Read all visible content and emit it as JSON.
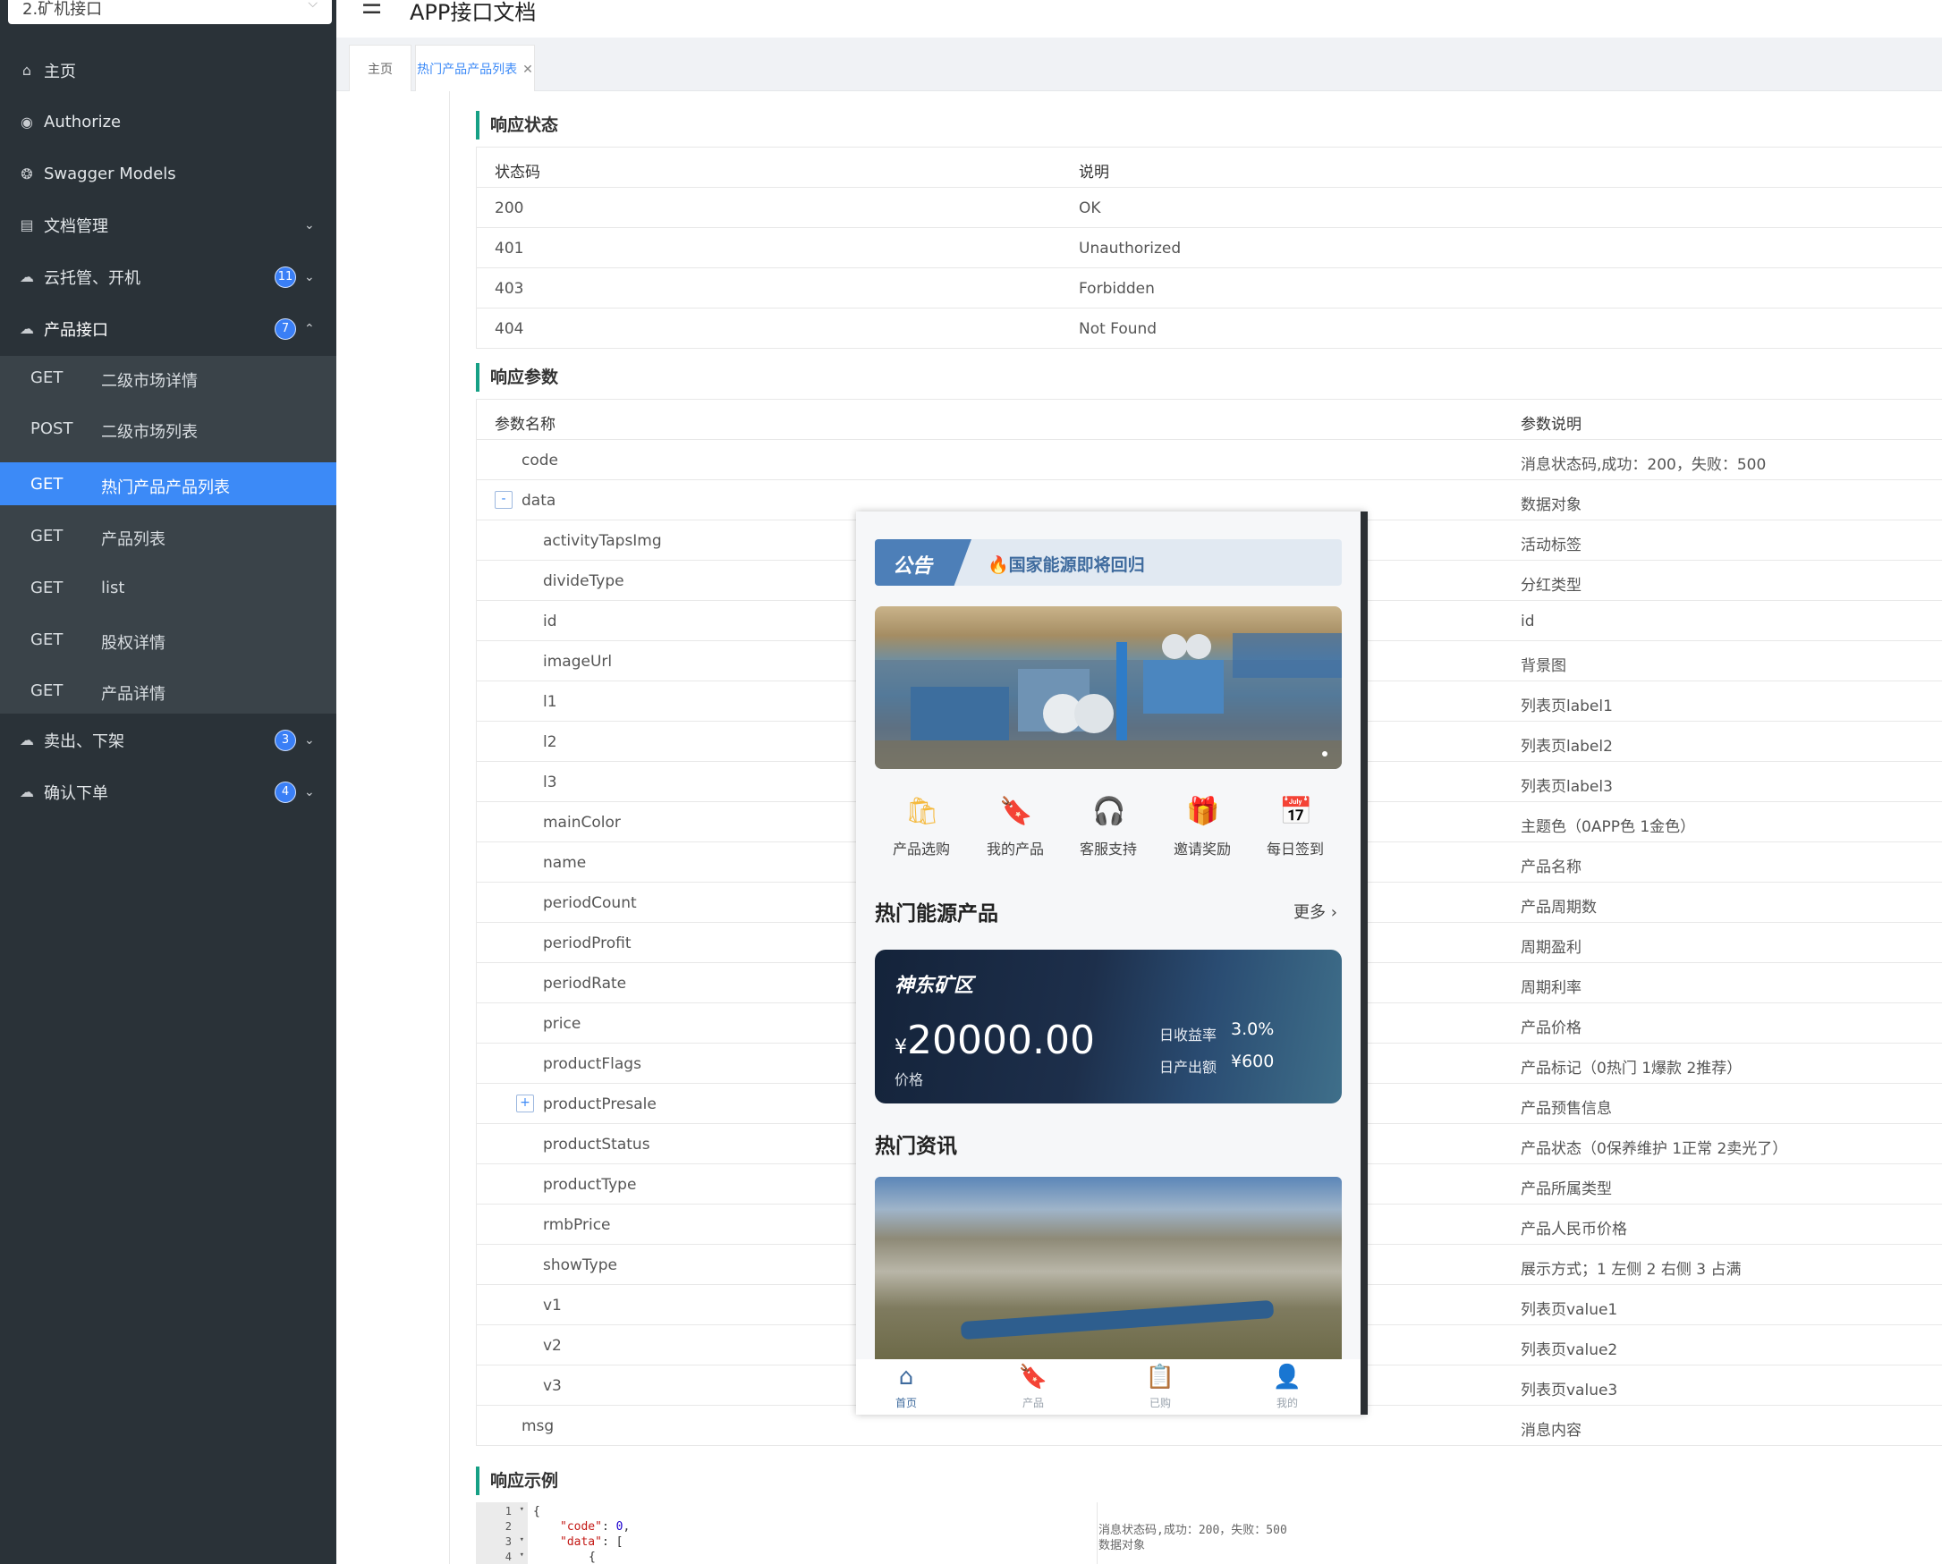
{
  "sidebar": {
    "group_select": "2.矿机接口",
    "menu": [
      {
        "icon": "home-icon",
        "glyph": "⌂",
        "label": "主页"
      },
      {
        "icon": "authorize-icon",
        "glyph": "◉",
        "label": "Authorize"
      },
      {
        "icon": "models-icon",
        "glyph": "❂",
        "label": "Swagger Models"
      },
      {
        "icon": "document-icon",
        "glyph": "▤",
        "label": "文档管理"
      },
      {
        "icon": "cloud-icon",
        "glyph": "☁",
        "label": "云托管、开机",
        "badge": "11"
      },
      {
        "icon": "cloud-icon",
        "glyph": "☁",
        "label": "产品接口",
        "badge": "7"
      },
      {
        "icon": "cloud-icon",
        "glyph": "☁",
        "label": "卖出、下架",
        "badge": "3"
      },
      {
        "icon": "cloud-icon",
        "glyph": "☁",
        "label": "确认下单",
        "badge": "4"
      }
    ],
    "submenu": [
      {
        "method": "GET",
        "name": "二级市场详情"
      },
      {
        "method": "POST",
        "name": "二级市场列表"
      },
      {
        "method": "GET",
        "name": "热门产品产品列表"
      },
      {
        "method": "GET",
        "name": "产品列表"
      },
      {
        "method": "GET",
        "name": "list"
      },
      {
        "method": "GET",
        "name": "股权详情"
      },
      {
        "method": "GET",
        "name": "产品详情"
      }
    ]
  },
  "header": {
    "title": "APP接口文档"
  },
  "tabs": {
    "home": "主页",
    "current": "热门产品产品列表"
  },
  "response_status": {
    "title": "响应状态",
    "headers": [
      "状态码",
      "说明"
    ],
    "rows": [
      [
        "200",
        "OK"
      ],
      [
        "401",
        "Unauthorized"
      ],
      [
        "403",
        "Forbidden"
      ],
      [
        "404",
        "Not Found"
      ]
    ]
  },
  "response_params": {
    "title": "响应参数",
    "headers": [
      "参数名称",
      "参数说明"
    ],
    "rows": [
      [
        "code",
        "消息状态码,成功：200，失败：500"
      ],
      [
        "data",
        "数据对象"
      ],
      [
        "activityTapsImg",
        "活动标签"
      ],
      [
        "divideType",
        "分红类型"
      ],
      [
        "id",
        "id"
      ],
      [
        "imageUrl",
        "背景图"
      ],
      [
        "l1",
        "列表页label1"
      ],
      [
        "l2",
        "列表页label2"
      ],
      [
        "l3",
        "列表页label3"
      ],
      [
        "mainColor",
        "主题色（0APP色 1金色）"
      ],
      [
        "name",
        "产品名称"
      ],
      [
        "periodCount",
        "产品周期数"
      ],
      [
        "periodProfit",
        "周期盈利"
      ],
      [
        "periodRate",
        "周期利率"
      ],
      [
        "price",
        "产品价格"
      ],
      [
        "productFlags",
        "产品标记（0热门 1爆款 2推荐）"
      ],
      [
        "productPresale",
        "产品预售信息"
      ],
      [
        "productStatus",
        "产品状态（0保养维护 1正常 2卖光了）"
      ],
      [
        "productType",
        "产品所属类型"
      ],
      [
        "rmbPrice",
        "产品人民币价格"
      ],
      [
        "showType",
        "展示方式；1 左侧 2 右侧 3 占满"
      ],
      [
        "v1",
        "列表页value1"
      ],
      [
        "v2",
        "列表页value2"
      ],
      [
        "v3",
        "列表页value3"
      ],
      [
        "msg",
        "消息内容"
      ]
    ],
    "toggles": {
      "data": "-",
      "productPresale": "+"
    }
  },
  "response_example": {
    "title": "响应示例",
    "lines": [
      "1",
      "2",
      "3",
      "4"
    ],
    "code_l1": "{",
    "code_l2_key": "\"code\"",
    "code_l2_val": "0",
    "code_l3_key": "\"data\"",
    "code_l3_rest": ": [",
    "code_l4": "{",
    "comment_code": "消息状态码,成功：200，失败：500",
    "comment_data": "数据对象"
  },
  "phone": {
    "notice_tag": "公告",
    "notice_text": "🔥国家能源即将回归",
    "quick_icons": [
      {
        "icon": "bag-icon",
        "glyph": "🛍",
        "label": "产品选购",
        "color": "#f5b93c"
      },
      {
        "icon": "bookmark-icon",
        "glyph": "🔖",
        "label": "我的产品",
        "color": "#e8463a"
      },
      {
        "icon": "headset-icon",
        "glyph": "🎧",
        "label": "客服支持",
        "color": "#8b5cf6"
      },
      {
        "icon": "gift-icon",
        "glyph": "🎁",
        "label": "邀请奖励",
        "color": "#e8463a"
      },
      {
        "icon": "calendar-icon",
        "glyph": "📅",
        "label": "每日签到",
        "color": "#f5b93c"
      }
    ],
    "hot_title": "热门能源产品",
    "more": "更多 ›",
    "product": {
      "name": "神东矿区",
      "currency": "¥",
      "price": "20000.00",
      "price_label": "价格",
      "rate_label": "日收益率",
      "rate": "3.0%",
      "output_label": "日产出额",
      "output": "¥600"
    },
    "news_title": "热门资讯",
    "tabs": [
      {
        "icon": "home-icon",
        "glyph": "⌂",
        "label": "首页"
      },
      {
        "icon": "product-icon",
        "glyph": "🔖",
        "label": "产品"
      },
      {
        "icon": "purchased-icon",
        "glyph": "📋",
        "label": "已购"
      },
      {
        "icon": "profile-icon",
        "glyph": "👤",
        "label": "我的"
      }
    ]
  }
}
